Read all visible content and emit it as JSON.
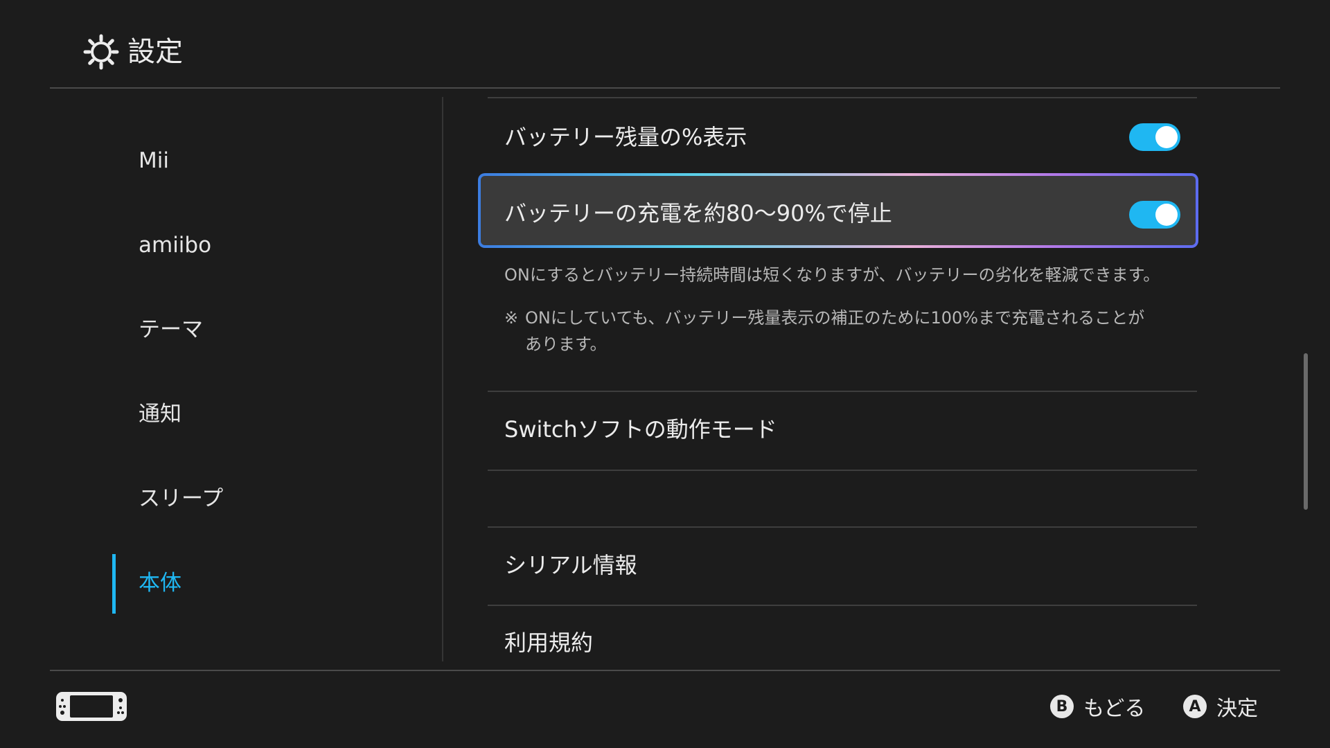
{
  "header": {
    "title": "設定",
    "icon": "gear-icon"
  },
  "sidebar": {
    "items": [
      {
        "label": "Mii",
        "active": false
      },
      {
        "label": "amiibo",
        "active": false
      },
      {
        "label": "テーマ",
        "active": false
      },
      {
        "label": "通知",
        "active": false
      },
      {
        "label": "スリープ",
        "active": false
      },
      {
        "label": "本体",
        "active": true
      }
    ]
  },
  "main": {
    "battery_percent": {
      "label": "バッテリー残量の%表示",
      "enabled": true
    },
    "battery_charge_limit": {
      "label": "バッテリーの充電を約80〜90%で停止",
      "enabled": true,
      "description": "ONにするとバッテリー持続時間は短くなりますが、バッテリーの劣化を軽減できます。",
      "note_mark": "※",
      "note": "ONにしていても、バッテリー残量表示の補正のために100%まで充電されることが\nあります。"
    },
    "switch_soft_mode": {
      "label": "Switchソフトの動作モード"
    },
    "serial_info": {
      "label": "シリアル情報"
    },
    "terms": {
      "label": "利用規約"
    }
  },
  "footer": {
    "console_icon": "switch-console-icon",
    "back": {
      "button": "B",
      "label": "もどる"
    },
    "confirm": {
      "button": "A",
      "label": "決定"
    }
  },
  "colors": {
    "background": "#1c1c1c",
    "accent": "#1fb7f2",
    "focus_row": "#3a3a3a"
  }
}
